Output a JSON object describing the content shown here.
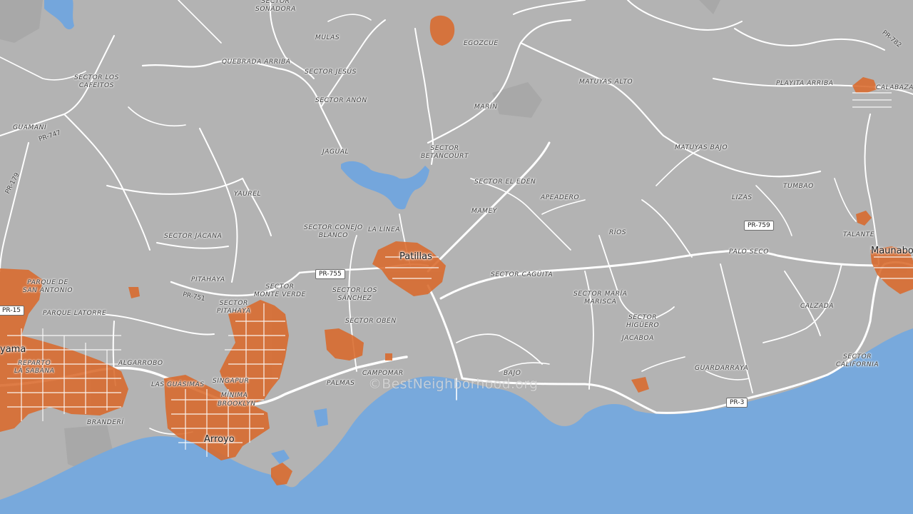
{
  "map": {
    "colors": {
      "land": "#b3b3b3",
      "sea": "#78a9dc",
      "water": "#74a6dc",
      "road": "#ffffff",
      "highlight": "#d96a2c",
      "urban": "#a9a9a9"
    },
    "towns": [
      {
        "name": "Patillas"
      },
      {
        "name": "Arroyo"
      },
      {
        "name": "yama"
      },
      {
        "name": "Maunabo"
      }
    ],
    "places": [
      {
        "name": "SECTOR SONADORA",
        "lines": [
          "SECTOR",
          "SONADORA"
        ]
      },
      {
        "name": "MULAS"
      },
      {
        "name": "QUEBRADA ARRIBA"
      },
      {
        "name": "SECTOR JESÚS"
      },
      {
        "name": "SECTOR ANÓN"
      },
      {
        "name": "SECTOR LOS CAFEITOS",
        "lines": [
          "SECTOR LOS",
          "CAFEITOS"
        ]
      },
      {
        "name": "GUAMANÍ"
      },
      {
        "name": "EGOZCUE"
      },
      {
        "name": "MATUYAS ALTO"
      },
      {
        "name": "PLAYITA ARRIBA"
      },
      {
        "name": "CALABAZAS"
      },
      {
        "name": "MARÍN"
      },
      {
        "name": "SECTOR BETANCOURT",
        "lines": [
          "SECTOR",
          "BETANCOURT"
        ]
      },
      {
        "name": "MATUYAS BAJO"
      },
      {
        "name": "JAGUAL"
      },
      {
        "name": "YAUREL"
      },
      {
        "name": "SECTOR EL EDÉN"
      },
      {
        "name": "APEADERO"
      },
      {
        "name": "TUMBAO"
      },
      {
        "name": "LIZAS"
      },
      {
        "name": "MAMEY"
      },
      {
        "name": "SECTOR JÁCANA"
      },
      {
        "name": "SECTOR CONEJO BLANCO",
        "lines": [
          "SECTOR CONEJO",
          "BLANCO"
        ]
      },
      {
        "name": "LA LÍNEA"
      },
      {
        "name": "RÍOS"
      },
      {
        "name": "TALANTE"
      },
      {
        "name": "PALO SECO"
      },
      {
        "name": "PITAHAYA"
      },
      {
        "name": "SECTOR MONTE VERDE",
        "lines": [
          "SECTOR",
          "MONTE VERDE"
        ]
      },
      {
        "name": "SECTOR LOS SÁNCHEZ",
        "lines": [
          "SECTOR LOS",
          "SÁNCHEZ"
        ]
      },
      {
        "name": "SECTOR CAGÜITA"
      },
      {
        "name": "PARQUE DE SAN ANTONIO",
        "lines": [
          "PARQUE DE",
          "SAN ANTONIO"
        ]
      },
      {
        "name": "PARQUE LATORRE"
      },
      {
        "name": "SECTOR PITAHAYA",
        "lines": [
          "SECTOR",
          "PITAHAYA"
        ]
      },
      {
        "name": "SECTOR MARÍA MARISCA",
        "lines": [
          "SECTOR MARÍA",
          "MARISCA"
        ]
      },
      {
        "name": "SECTOR HIGÜERO",
        "lines": [
          "SECTOR",
          "HIGÜERO"
        ]
      },
      {
        "name": "SECTOR OBÉN"
      },
      {
        "name": "JACABOA"
      },
      {
        "name": "CALZADA"
      },
      {
        "name": "SECTOR CALIFORNIA",
        "lines": [
          "SECTOR",
          "CALIFORNIA"
        ]
      },
      {
        "name": "ALGARROBO"
      },
      {
        "name": "REPARTO LA SABANA",
        "lines": [
          "REPARTO",
          "LA SABANA"
        ]
      },
      {
        "name": "CAMPOMAR"
      },
      {
        "name": "GUARDARRAYA"
      },
      {
        "name": "LAS GUÁSIMAS"
      },
      {
        "name": "SINGAPUR"
      },
      {
        "name": "MÍNIMA"
      },
      {
        "name": "BROOKLYN"
      },
      {
        "name": "PALMAS"
      },
      {
        "name": "BAJO"
      },
      {
        "name": "BRANDERÍ"
      }
    ],
    "route_shields": [
      {
        "label": "PR-755"
      },
      {
        "label": "PR-759"
      },
      {
        "label": "PR-3"
      },
      {
        "label": "PR-15"
      }
    ],
    "road_labels": [
      {
        "label": "PR-747"
      },
      {
        "label": "PR-179"
      },
      {
        "label": "PR-751"
      },
      {
        "label": "PR-782"
      }
    ],
    "watermark": "©BestNeighborhood.org"
  }
}
